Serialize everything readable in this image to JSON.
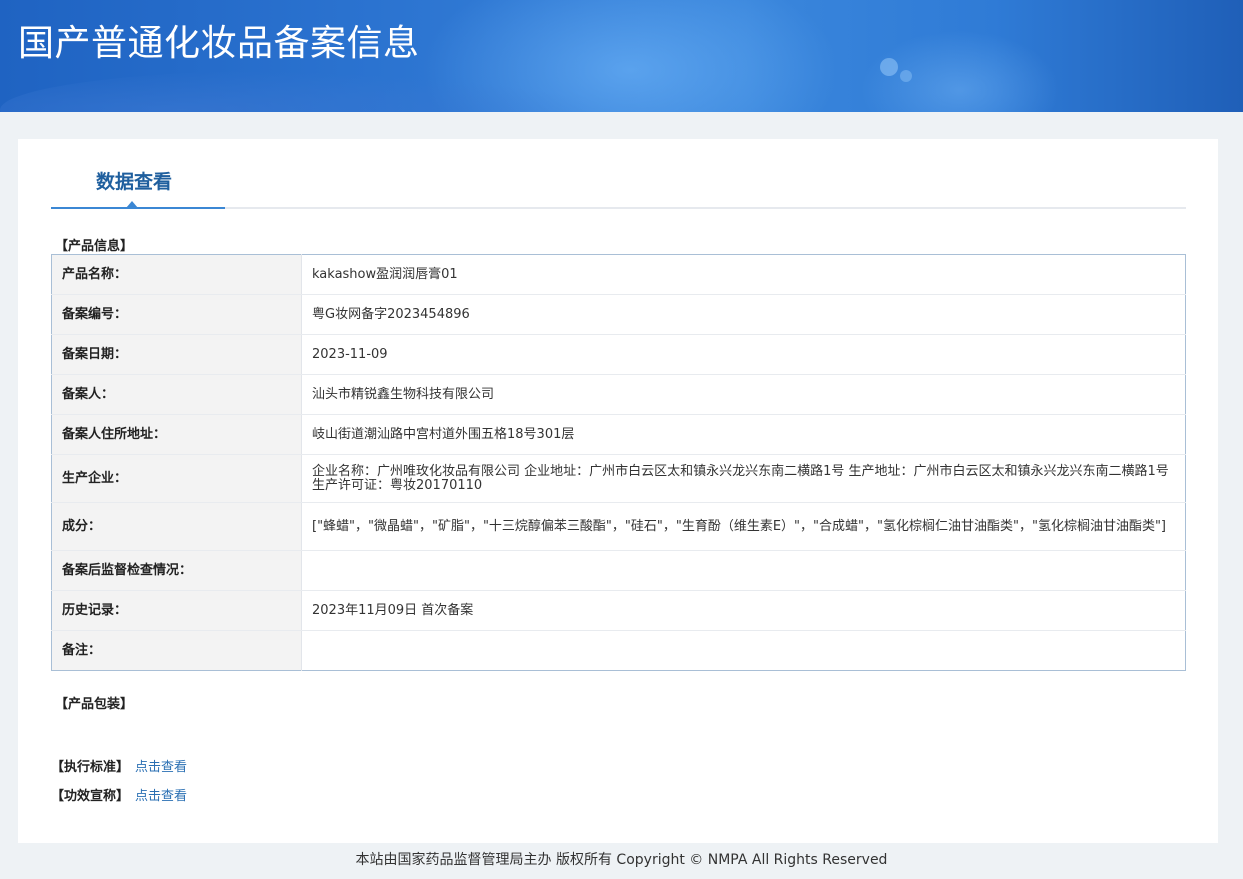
{
  "header": {
    "title": "国产普通化妆品备案信息"
  },
  "tabs": [
    {
      "label": "数据查看"
    }
  ],
  "sections": {
    "product_info": "【产品信息】",
    "packaging": "【产品包装】",
    "standard": "【执行标准】",
    "efficacy": "【功效宣称】"
  },
  "links": {
    "standard_link": "点击查看",
    "efficacy_link": "点击查看"
  },
  "rows": [
    {
      "label": "产品名称：",
      "value": "kakashow盈润润唇膏01"
    },
    {
      "label": "备案编号：",
      "value": "粤G妆网备字2023454896"
    },
    {
      "label": "备案日期：",
      "value": "2023-11-09"
    },
    {
      "label": "备案人：",
      "value": "汕头市精锐鑫生物科技有限公司"
    },
    {
      "label": "备案人住所地址：",
      "value": "岐山街道潮汕路中宫村道外围五格18号301层"
    },
    {
      "label": "生产企业：",
      "value": "企业名称：广州唯玫化妆品有限公司 企业地址：广州市白云区太和镇永兴龙兴东南二横路1号 生产地址：广州市白云区太和镇永兴龙兴东南二横路1号 生产许可证：粤妆20170110"
    },
    {
      "label": "成分：",
      "value": "[\"蜂蜡\"，\"微晶蜡\"，\"矿脂\"，\"十三烷醇偏苯三酸酯\"，\"硅石\"，\"生育酚（维生素E）\"，\"合成蜡\"，\"氢化棕榈仁油甘油酯类\"，\"氢化棕榈油甘油酯类\"]"
    },
    {
      "label": "备案后监督检查情况：",
      "value": ""
    },
    {
      "label": "历史记录：",
      "value": "2023年11月09日 首次备案"
    },
    {
      "label": "备注：",
      "value": ""
    }
  ],
  "footer": {
    "text": "本站由国家药品监督管理局主办 版权所有 Copyright © NMPA All Rights Reserved"
  }
}
